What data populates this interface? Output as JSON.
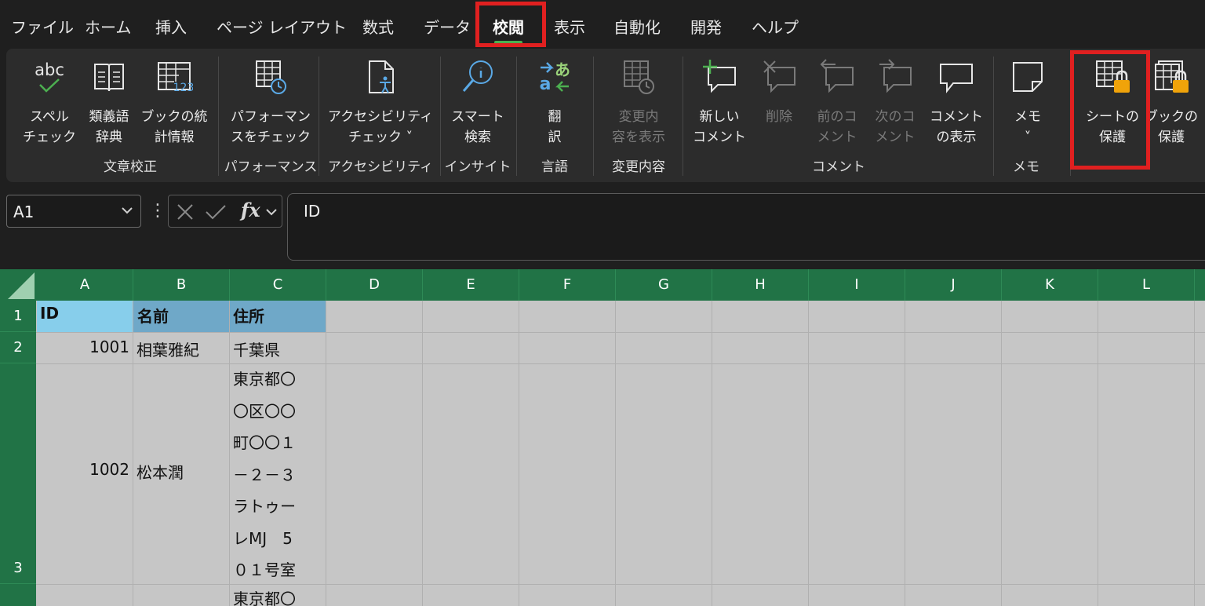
{
  "menu": {
    "tabs": [
      {
        "label": "ファイル"
      },
      {
        "label": "ホーム"
      },
      {
        "label": "挿入"
      },
      {
        "label": "ページ レイアウト"
      },
      {
        "label": "数式"
      },
      {
        "label": "データ"
      },
      {
        "label": "校閲"
      },
      {
        "label": "表示"
      },
      {
        "label": "自動化"
      },
      {
        "label": "開発"
      },
      {
        "label": "ヘルプ"
      }
    ],
    "active_tab": "校閲"
  },
  "ribbon": {
    "buttons": {
      "spell": "スペル\nチェック",
      "thesaurus": "類義語\n辞典",
      "stats": "ブックの統\n計情報",
      "perf": "パフォーマン\nスをチェック",
      "access": "アクセシビリティ\nチェック ˅",
      "smart": "スマート\n検索",
      "translate": "翻\n訳",
      "changes": "変更内\n容を表示",
      "new_comment": "新しい\nコメント",
      "delete": "削除",
      "prev_comment": "前のコ\nメント",
      "next_comment": "次のコ\nメント",
      "show_comments": "コメント\nの表示",
      "memo": "メモ\n˅",
      "protect_sheet": "シートの\n保護",
      "protect_book": "ブックの\n保護"
    },
    "groups": {
      "proofing": "文章校正",
      "performance": "パフォーマンス",
      "accessibility": "アクセシビリティ",
      "insights": "インサイト",
      "language": "言語",
      "changes": "変更内容",
      "comments": "コメント",
      "notes": "メモ"
    },
    "icon_text": {
      "abc": "abc",
      "num": "123"
    }
  },
  "formula_bar": {
    "name_box": "A1",
    "fx": "fx",
    "formula": "ID"
  },
  "columns": [
    "A",
    "B",
    "C",
    "D",
    "E",
    "F",
    "G",
    "H",
    "I",
    "J",
    "K",
    "L"
  ],
  "rows": [
    "1",
    "2",
    "3"
  ],
  "cells": {
    "a1": "ID",
    "b1": "名前",
    "c1": "住所",
    "a2": "1001",
    "b2": "相葉雅紀",
    "c2": "千葉県",
    "a3": "1002",
    "b3": "松本潤",
    "c3_lines": [
      "東京都〇",
      "〇区〇〇",
      "町〇〇１",
      "－２－３",
      "ラトゥー",
      "レMJ　5",
      "０１号室"
    ],
    "c4": "東京都〇"
  },
  "colors": {
    "header_green": "#217346",
    "highlight_red": "#e02020",
    "header_fill_a": "#87ceeb",
    "header_fill_bc": "#6fa8c8",
    "lock_orange": "#f0a30a"
  }
}
